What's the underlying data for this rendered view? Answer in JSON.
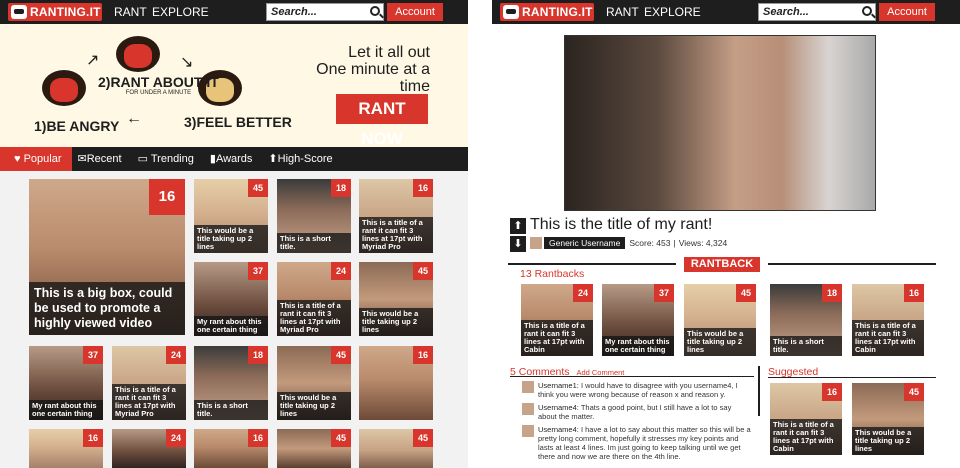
{
  "nav": {
    "logo": "RANTING.IT",
    "rant": "RANT",
    "explore": "EXPLORE",
    "search_placeholder": "Search...",
    "account": "Account"
  },
  "hero": {
    "step1": "1)BE ANGRY",
    "step2": "2)RANT ABOUT IT",
    "step2_sub": "FOR UNDER A MINUTE",
    "step3": "3)FEEL BETTER",
    "tagline1": "Let it all out",
    "tagline2": "One minute at a time",
    "cta": "RANT NOW"
  },
  "tabs": [
    "Popular",
    "Recent",
    "Trending",
    "Awards",
    "High-Score"
  ],
  "grid": {
    "big": {
      "count": "16",
      "caption": "This is a big box, could be used to promote a highly viewed video"
    },
    "tiles": [
      {
        "count": "45",
        "caption": "This would be a title taking up 2 lines"
      },
      {
        "count": "18",
        "caption": "This is a short title."
      },
      {
        "count": "16",
        "caption": "This is a title of a rant it can fit 3 lines at 17pt with Myriad Pro"
      },
      {
        "count": "37",
        "caption": "My rant about this one certain thing"
      },
      {
        "count": "24",
        "caption": "This is a title of a rant it can fit 3 lines at 17pt with Myriad Pro"
      },
      {
        "count": "45",
        "caption": "This would be a title taking up 2 lines"
      },
      {
        "count": "37",
        "caption": "My rant about this one certain thing"
      },
      {
        "count": "24",
        "caption": "This is a title of a rant it can fit 3 lines at 17pt with Myriad Pro"
      },
      {
        "count": "18",
        "caption": "This is a short title."
      },
      {
        "count": "45",
        "caption": "This would be a title taking up 2 lines"
      },
      {
        "count": "16",
        "caption": ""
      },
      {
        "count": "24",
        "caption": ""
      },
      {
        "count": "16",
        "caption": ""
      },
      {
        "count": "45",
        "caption": ""
      }
    ]
  },
  "rant": {
    "title": "This is the title of my rant!",
    "username": "Generic Username",
    "score": "Score: 453",
    "views": "Views: 4,324",
    "rantback_button": "RANTBACK",
    "rantbacks_count": "13 Rantbacks",
    "rantbacks": [
      {
        "count": "24",
        "caption": "This is a title of a rant it can fit 3 lines at 17pt with Cabin"
      },
      {
        "count": "37",
        "caption": "My rant about this one certain thing"
      },
      {
        "count": "45",
        "caption": "This would be a title taking up 2 lines"
      },
      {
        "count": "18",
        "caption": "This is a short title."
      },
      {
        "count": "16",
        "caption": "This is a title of a rant it can fit 3 lines at 17pt with Cabin"
      }
    ],
    "comments_count": "5 Comments",
    "add_comment": "Add Comment",
    "comments": [
      {
        "user": "Username1:",
        "text": "I would have to disagree with you username4, I think you were wrong because of reason x and reason y."
      },
      {
        "user": "Username4:",
        "text": "Thats a good point, but I still have a lot to say about the matter."
      },
      {
        "user": "Username4:",
        "text": "I have a lot to say about this matter so this will be a pretty long comment, hopefully it stresses my key points and lasts at least 4 lines. Im just going to keep talking until we get there and now we are there on the 4th line."
      }
    ],
    "suggested_label": "Suggested",
    "suggested": [
      {
        "count": "16",
        "caption": "This is a title of a rant it can fit 3 lines at 17pt with Cabin"
      },
      {
        "count": "45",
        "caption": "This would be a title taking up 2 lines"
      }
    ]
  },
  "colors": {
    "accent": "#d8362c",
    "dark": "#1e1e1e",
    "hero_bg": "#fff8e4"
  }
}
